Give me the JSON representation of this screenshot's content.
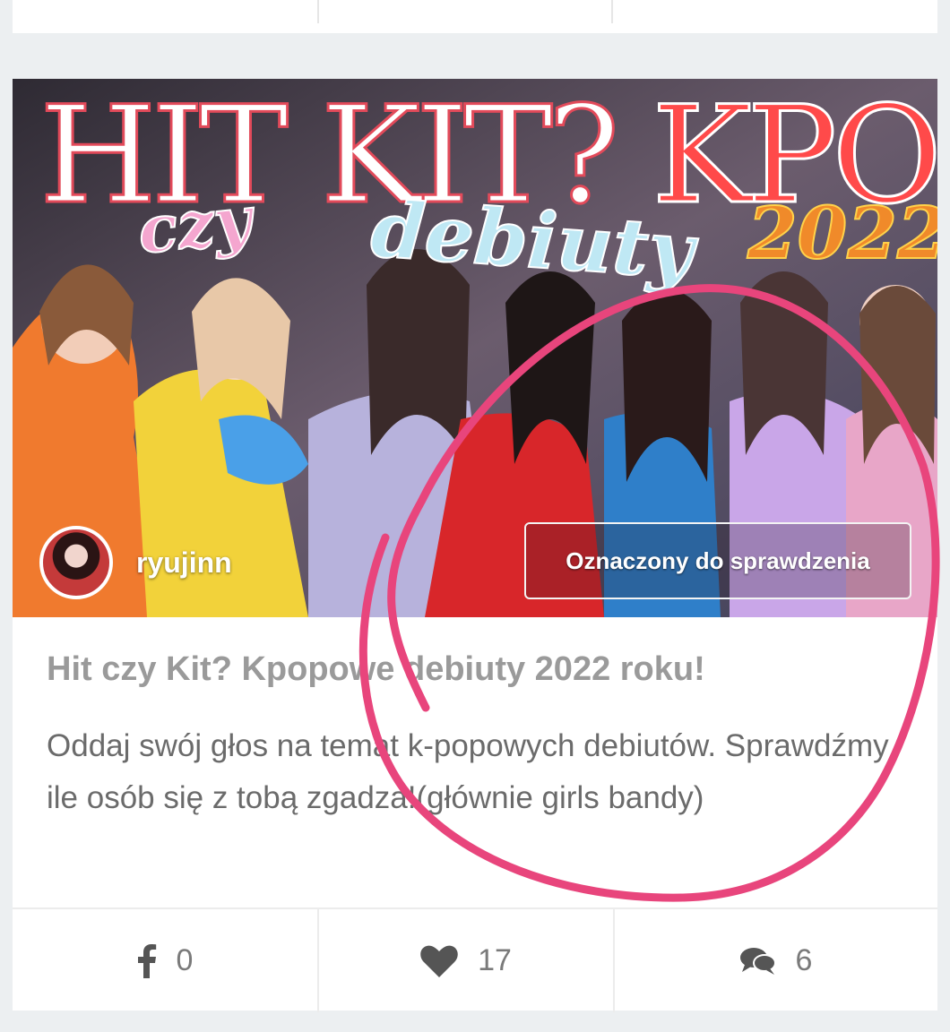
{
  "thumbnail": {
    "headline_left": "HIT KIT?",
    "headline_right": "KPOPOWE",
    "script_czy": "czy",
    "script_debiuty": "debiuty",
    "script_year": "2022"
  },
  "author": {
    "name": "ryujinn"
  },
  "badge": {
    "label": "Oznaczony do sprawdzenia"
  },
  "post": {
    "title": "Hit czy Kit? Kpopowe debiuty 2022 roku!",
    "description": "Oddaj swój głos na temat k-popowych debiutów. Sprawdźmy ile osób się z tobą zgadza!(głównie girls bandy)"
  },
  "stats": {
    "shares": "0",
    "likes": "17",
    "comments": "6"
  },
  "colors": {
    "annotation": "#e8457c",
    "title_text": "#9a9a9a",
    "desc_text": "#6b6b6b",
    "card_bg": "#ffffff",
    "page_bg": "#eceff1"
  },
  "icons": {
    "share": "facebook-icon",
    "like": "heart-icon",
    "comment": "comments-icon"
  }
}
